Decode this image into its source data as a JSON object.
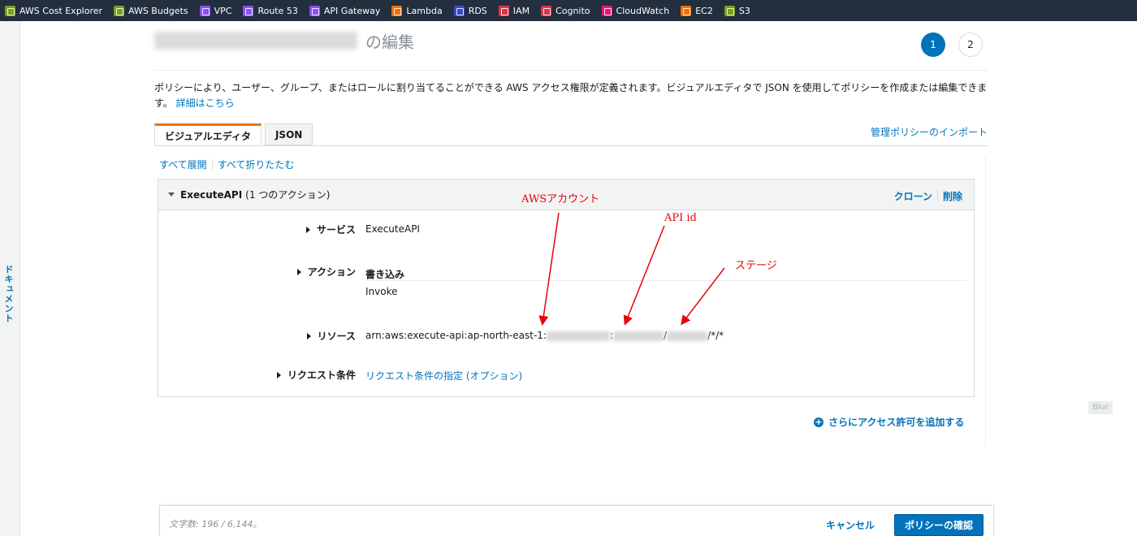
{
  "services_bar": [
    {
      "label": "AWS Cost Explorer",
      "color": "#7aa116",
      "icon": "cost-explorer-icon"
    },
    {
      "label": "AWS Budgets",
      "color": "#7aa116",
      "icon": "budgets-icon"
    },
    {
      "label": "VPC",
      "color": "#8c4fff",
      "icon": "vpc-icon"
    },
    {
      "label": "Route 53",
      "color": "#8c4fff",
      "icon": "route53-icon"
    },
    {
      "label": "API Gateway",
      "color": "#8c4fff",
      "icon": "api-gateway-icon"
    },
    {
      "label": "Lambda",
      "color": "#ed7100",
      "icon": "lambda-icon"
    },
    {
      "label": "RDS",
      "color": "#3b48cc",
      "icon": "rds-icon"
    },
    {
      "label": "IAM",
      "color": "#dd344c",
      "icon": "iam-icon"
    },
    {
      "label": "Cognito",
      "color": "#dd344c",
      "icon": "cognito-icon"
    },
    {
      "label": "CloudWatch",
      "color": "#e7157b",
      "icon": "cloudwatch-icon"
    },
    {
      "label": "EC2",
      "color": "#ed7100",
      "icon": "ec2-icon"
    },
    {
      "label": "S3",
      "color": "#7aa116",
      "icon": "s3-icon"
    }
  ],
  "left_rail": {
    "doc_label": "ドキュメント"
  },
  "header": {
    "title_suffix": "の編集",
    "steps": [
      "1",
      "2"
    ],
    "description": "ポリシーにより、ユーザー、グループ、またはロールに割り当てることができる AWS アクセス権限が定義されます。ビジュアルエディタで JSON を使用してポリシーを作成または編集できます。",
    "learn_more": "詳細はこちら"
  },
  "tabs": {
    "visual": "ビジュアルエディタ",
    "json": "JSON",
    "import": "管理ポリシーのインポート"
  },
  "editor": {
    "expand_all": "すべて展開",
    "collapse_all": "すべて折りたたむ",
    "statement": {
      "service_name": "ExecuteAPI",
      "action_count": "(1 つのアクション)",
      "clone": "クローン",
      "delete": "削除"
    },
    "rows": {
      "service_label": "サービス",
      "service_value": "ExecuteAPI",
      "action_label": "アクション",
      "action_group": "書き込み",
      "action_value": "Invoke",
      "resource_label": "リソース",
      "resource_prefix": "arn:aws:execute-api:ap-north-east-1:",
      "resource_sep1": ":",
      "resource_sep2": "/",
      "resource_suffix": "/*/*",
      "condition_label": "リクエスト条件",
      "condition_value": "リクエスト条件の指定 (オプション)"
    },
    "add_permissions": "さらにアクセス許可を追加する",
    "blur_badge": "Blur"
  },
  "annotations": {
    "aws_account": "AWSアカウント",
    "api_id": "API id",
    "stage": "ステージ",
    "color": "#e8000b"
  },
  "footer": {
    "char_count": "文字数: 196 / 6,144。",
    "cancel": "キャンセル",
    "review": "ポリシーの確認"
  }
}
